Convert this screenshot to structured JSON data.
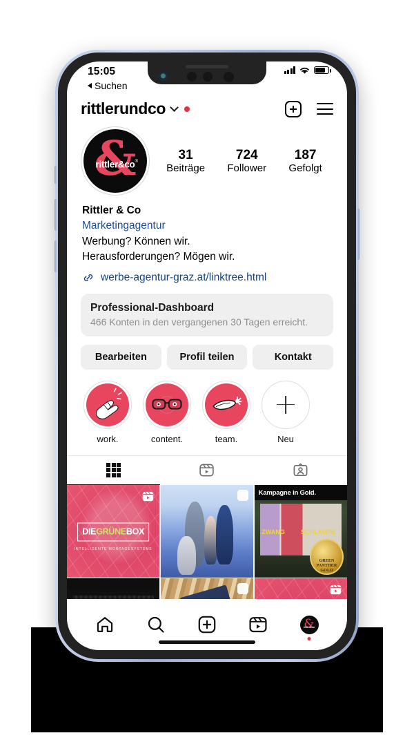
{
  "status_bar": {
    "time": "15:05",
    "back_label": "Suchen",
    "signal_icon": "cellular-bars-icon",
    "wifi_icon": "wifi-icon",
    "battery_icon": "battery-icon"
  },
  "header": {
    "handle": "rittlerundco",
    "chevron_icon": "chevron-down-icon",
    "live_dot": "red-dot-indicator",
    "new_post_icon": "plus-square-icon",
    "menu_icon": "hamburger-menu-icon"
  },
  "profile": {
    "avatar_alt": "rittler&co",
    "avatar_mark": "&",
    "avatar_wordmark": "rittler&co",
    "stats": [
      {
        "num": "31",
        "label": "Beiträge"
      },
      {
        "num": "724",
        "label": "Follower"
      },
      {
        "num": "187",
        "label": "Gefolgt"
      }
    ],
    "display_name": "Rittler & Co",
    "category": "Marketingagentur",
    "bio_line_1": "Werbung? Können wir.",
    "bio_line_2": "Herausforderungen? Mögen wir.",
    "link_icon": "link-chain-icon",
    "link": "werbe-agentur-graz.at/linktree.html"
  },
  "dashboard": {
    "title": "Professional-Dashboard",
    "subtitle": "466 Konten in den vergangenen 30 Tagen erreicht."
  },
  "actions": [
    {
      "label": "Bearbeiten"
    },
    {
      "label": "Profil teilen"
    },
    {
      "label": "Kontakt"
    }
  ],
  "highlights": [
    {
      "label": "work.",
      "icon": "clapping-hands-icon"
    },
    {
      "label": "content.",
      "icon": "eyeglasses-icon"
    },
    {
      "label": "team.",
      "icon": "megaphone-icon"
    },
    {
      "label": "Neu",
      "icon": "plus-icon"
    }
  ],
  "tabs": [
    {
      "name": "grid",
      "icon": "grid-icon",
      "selected": true
    },
    {
      "name": "reels",
      "icon": "reels-icon",
      "selected": false
    },
    {
      "name": "tagged",
      "icon": "tagged-person-icon",
      "selected": false
    }
  ],
  "grid": [
    {
      "id": "post-1",
      "badge": "reel",
      "caption": "DIE GRÜNE BOX",
      "caption_part_1": "DIE",
      "caption_part_2": "GRÜNE",
      "caption_part_3": "BOX",
      "subcaption": "INTELLIGENTE  MONTAGESYSTEME"
    },
    {
      "id": "post-2",
      "badge": "multi",
      "caption": ""
    },
    {
      "id": "post-3",
      "badge": "none",
      "caption": "Kampagne in Gold.",
      "poster_1": "ZWANG",
      "poster_2": "SCHLAMPE",
      "medal_line_1": "GREEN",
      "medal_line_2": "PANTHER",
      "medal_line_3": "GOLD"
    },
    {
      "id": "post-4",
      "badge": "none",
      "caption": ""
    },
    {
      "id": "post-5",
      "badge": "multi",
      "caption": ""
    },
    {
      "id": "post-6",
      "badge": "reel",
      "caption": ""
    }
  ],
  "bottom_nav": [
    {
      "name": "home",
      "icon": "home-icon",
      "active": true
    },
    {
      "name": "search",
      "icon": "search-icon",
      "active": false
    },
    {
      "name": "create",
      "icon": "plus-square-icon",
      "active": false
    },
    {
      "name": "reels",
      "icon": "reels-icon",
      "active": false
    },
    {
      "name": "profile",
      "icon": "profile-avatar-icon",
      "active": false
    }
  ],
  "colors": {
    "brand_pink": "#e8455f",
    "link_blue": "#16437f",
    "chip_gray": "#efefef",
    "muted_text": "#8e8e8e",
    "notification_red": "#ed2d3f"
  }
}
